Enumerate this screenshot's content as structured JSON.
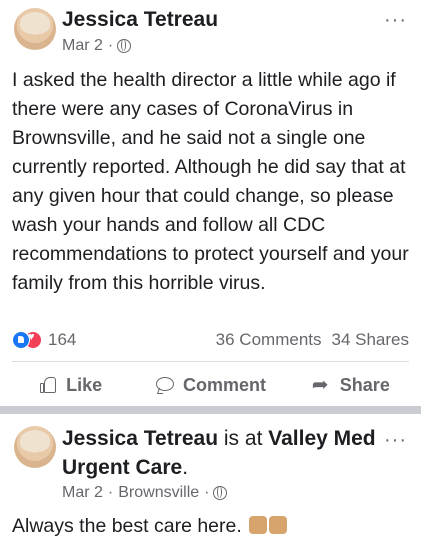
{
  "post1": {
    "author": "Jessica Tetreau",
    "date": "Mar 2",
    "meta_separator": "·",
    "privacy_icon": "globe-icon",
    "more_label": "···",
    "text": "I asked the health director a little while ago if there were any cases of CoronaVirus in Brownsville, and he said not a single one currently reported. Although he did say that at any given hour that could change, so please wash your hands and follow all CDC recommendations to protect yourself and your family from this horrible virus.",
    "reaction_count": "164",
    "comments": "36 Comments",
    "shares": "34 Shares",
    "actions": {
      "like": "Like",
      "comment": "Comment",
      "share": "Share"
    }
  },
  "post2": {
    "author": "Jessica Tetreau",
    "connector": "is at",
    "place": "Valley Med Urgent Care",
    "period": ".",
    "date": "Mar 2",
    "location": "Brownsville",
    "meta_separator": "·",
    "more_label": "···",
    "text": "Always the best care here."
  },
  "colors": {
    "primary_text": "#1c1e21",
    "secondary_text": "#65676b",
    "like_blue": "#1877f2",
    "love_red": "#f33e58",
    "separator": "#c9ccd1"
  }
}
